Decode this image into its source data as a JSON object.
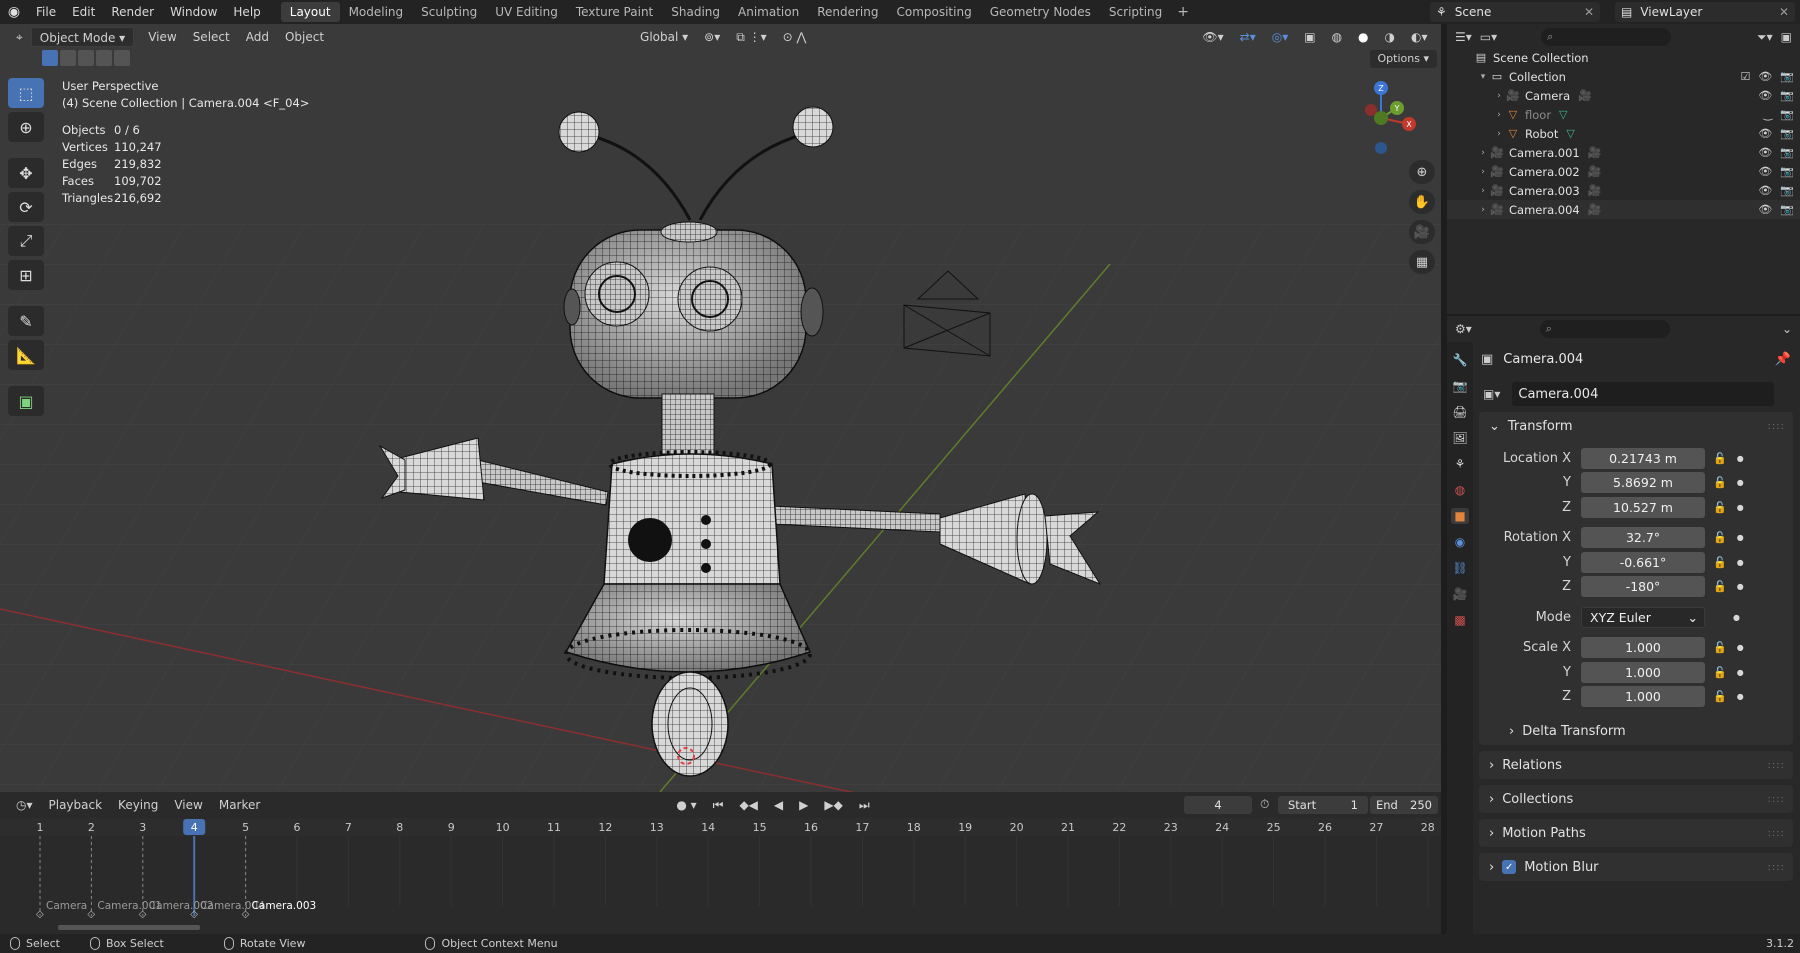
{
  "topbar": {
    "menus": [
      "File",
      "Edit",
      "Render",
      "Window",
      "Help"
    ],
    "workspaces": [
      "Layout",
      "Modeling",
      "Sculpting",
      "UV Editing",
      "Texture Paint",
      "Shading",
      "Animation",
      "Rendering",
      "Compositing",
      "Geometry Nodes",
      "Scripting"
    ],
    "active_workspace": "Layout",
    "scene": "Scene",
    "view_layer": "ViewLayer"
  },
  "viewport": {
    "mode": "Object Mode",
    "menus": [
      "View",
      "Select",
      "Add",
      "Object"
    ],
    "orientation": "Global",
    "options_label": "Options",
    "perspective": "User Perspective",
    "context": "(4) Scene Collection | Camera.004 <F_04>",
    "stats": [
      {
        "key": "Objects",
        "value": "0 / 6"
      },
      {
        "key": "Vertices",
        "value": "110,247"
      },
      {
        "key": "Edges",
        "value": "219,832"
      },
      {
        "key": "Faces",
        "value": "109,702"
      },
      {
        "key": "Triangles",
        "value": "216,692"
      }
    ],
    "gizmo": {
      "x": "X",
      "y": "Y",
      "z": "Z"
    }
  },
  "timeline": {
    "menus": [
      "Playback",
      "Keying",
      "View",
      "Marker"
    ],
    "current_frame": "4",
    "start_label": "Start",
    "start": "1",
    "end_label": "End",
    "end": "250",
    "ruler": [
      "1",
      "2",
      "3",
      "4",
      "5",
      "6",
      "7",
      "8",
      "9",
      "10",
      "11",
      "12",
      "13",
      "14",
      "15",
      "16",
      "17",
      "18",
      "19",
      "20",
      "21",
      "22",
      "23",
      "24",
      "25",
      "26",
      "27",
      "28"
    ],
    "markers": [
      "Camera",
      "Camera.001",
      "Camera.002",
      "Camera.004",
      "Camera.003"
    ]
  },
  "statusbar": {
    "select": "Select",
    "box_select": "Box Select",
    "rotate_view": "Rotate View",
    "context_menu": "Object Context Menu",
    "version": "3.1.2"
  },
  "outliner": {
    "rows": [
      {
        "label": "Scene Collection",
        "indent": 0,
        "icon": "scene-collection-icon"
      },
      {
        "label": "Collection",
        "indent": 1,
        "icon": "collection-icon"
      },
      {
        "label": "Camera",
        "indent": 2,
        "icon": "camera-object-icon"
      },
      {
        "label": "floor",
        "indent": 2,
        "icon": "mesh-object-icon"
      },
      {
        "label": "Robot",
        "indent": 2,
        "icon": "mesh-object-icon"
      },
      {
        "label": "Camera.001",
        "indent": 1,
        "icon": "camera-object-icon"
      },
      {
        "label": "Camera.002",
        "indent": 1,
        "icon": "camera-object-icon"
      },
      {
        "label": "Camera.003",
        "indent": 1,
        "icon": "camera-object-icon"
      },
      {
        "label": "Camera.004",
        "indent": 1,
        "icon": "camera-object-icon"
      }
    ]
  },
  "properties": {
    "object_name": "Camera.004",
    "name_field": "Camera.004",
    "transform_label": "Transform",
    "location_label": "Location X",
    "location": [
      "0.21743 m",
      "5.8692 m",
      "10.527 m"
    ],
    "rotation_label": "Rotation X",
    "rotation": [
      "32.7°",
      "-0.661°",
      "-180°"
    ],
    "mode_label": "Mode",
    "mode": "XYZ Euler",
    "scale_label": "Scale X",
    "scale": [
      "1.000",
      "1.000",
      "1.000"
    ],
    "axis_y": "Y",
    "axis_z": "Z",
    "delta_transform": "Delta Transform",
    "panels": [
      "Relations",
      "Collections",
      "Motion Paths",
      "Motion Blur"
    ]
  },
  "colors": {
    "accent": "#4772b3",
    "x_axis": "#c0392b",
    "y_axis": "#6b9e2e",
    "z_axis": "#3b75d6",
    "camera_icon": "#e0853b",
    "data_icon": "#38b88a"
  }
}
